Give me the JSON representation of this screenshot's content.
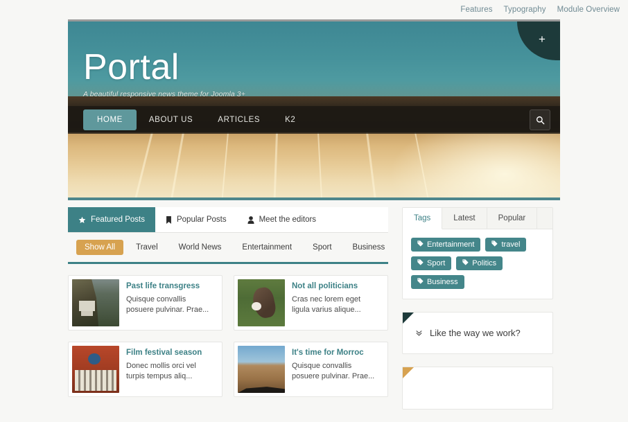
{
  "topbar": {
    "links": [
      {
        "label": "Features"
      },
      {
        "label": "Typography"
      },
      {
        "label": "Module Overview"
      }
    ]
  },
  "hero": {
    "brand_title": "Portal",
    "brand_tagline": "A beautiful responsive news theme for Joomla 3+",
    "corner_button_label": "+",
    "corner_button_icon": "plus-icon",
    "search_icon": "search-icon",
    "nav": [
      {
        "label": "HOME",
        "active": true
      },
      {
        "label": "ABOUT US",
        "active": false
      },
      {
        "label": "ARTICLES",
        "active": false
      },
      {
        "label": "K2",
        "active": false
      }
    ]
  },
  "main": {
    "tabs": [
      {
        "label": "Featured Posts",
        "icon": "star-icon",
        "active": true
      },
      {
        "label": "Popular Posts",
        "icon": "bookmark-icon",
        "active": false
      },
      {
        "label": "Meet the editors",
        "icon": "user-icon",
        "active": false
      }
    ],
    "filters": [
      {
        "label": "Show All",
        "active": true
      },
      {
        "label": "Travel",
        "active": false
      },
      {
        "label": "World News",
        "active": false
      },
      {
        "label": "Entertainment",
        "active": false
      },
      {
        "label": "Sport",
        "active": false
      },
      {
        "label": "Business",
        "active": false
      }
    ],
    "cards": [
      {
        "title": "Past life transgress",
        "excerpt": "Quisque convallis posuere pulvinar. Prae...",
        "thumb": "monastery-cliff-image"
      },
      {
        "title": "Not all politicians",
        "excerpt": "Cras nec lorem eget ligula varius alique...",
        "thumb": "donkey-field-image"
      },
      {
        "title": "Film festival season",
        "excerpt": "Donec mollis orci vel turpis tempus aliq...",
        "thumb": "cinema-building-image"
      },
      {
        "title": "It's time for Morroc",
        "excerpt": "Quisque convallis posuere pulvinar. Prae...",
        "thumb": "desert-road-image"
      }
    ]
  },
  "sidebar": {
    "tags_module": {
      "tabs": [
        {
          "label": "Tags",
          "active": true
        },
        {
          "label": "Latest",
          "active": false
        },
        {
          "label": "Popular",
          "active": false
        }
      ],
      "tags": [
        {
          "label": "Entertainment"
        },
        {
          "label": "travel"
        },
        {
          "label": "Sport"
        },
        {
          "label": "Politics"
        },
        {
          "label": "Business"
        }
      ],
      "tag_icon": "tag-icon"
    },
    "callout_module": {
      "heading": "Like the way we work?",
      "icon": "chevron-double-down-icon",
      "ribbon_color": "#1d3a3a"
    },
    "partial_module": {
      "ribbon_color": "#d7a250"
    }
  },
  "colors": {
    "accent_teal": "#3d8186",
    "nav_active_teal": "#5f989c",
    "gold": "#d7a250",
    "dark_teal": "#1d3a3a",
    "page_bg": "#f7f7f5"
  }
}
